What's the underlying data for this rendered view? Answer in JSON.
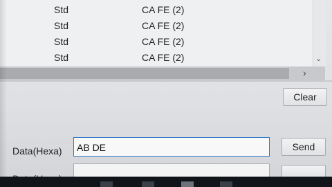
{
  "list": {
    "rows": [
      {
        "type": "Std",
        "data": "CA FE (2)"
      },
      {
        "type": "Std",
        "data": "CA FE (2)"
      },
      {
        "type": "Std",
        "data": "CA FE (2)"
      },
      {
        "type": "Std",
        "data": "CA FE (2)"
      }
    ]
  },
  "buttons": {
    "clear_label": "Clear",
    "send_label": "Send",
    "send2_label": ""
  },
  "send_panel": {
    "data_label": "Data(Hexa)",
    "data_value": "AB DE",
    "data2_label": "Data(Hexa)"
  },
  "icons": {
    "scroll_down": "chevron-down-icon",
    "scroll_right": "chevron-right-icon",
    "cursor": "mouse-pointer-icon"
  }
}
